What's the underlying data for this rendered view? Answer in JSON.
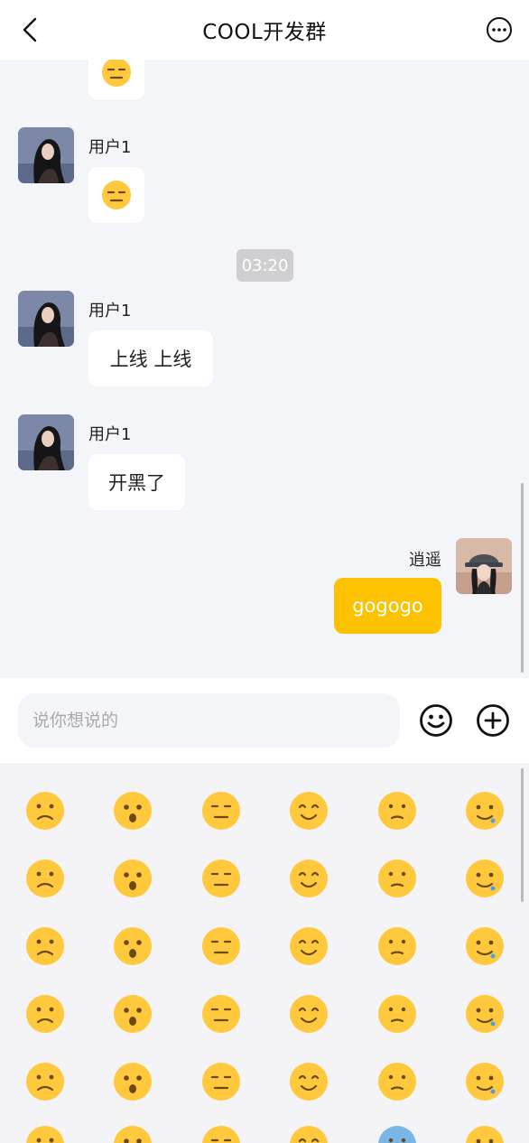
{
  "header": {
    "title": "COOL开发群"
  },
  "chat": {
    "messages": [
      {
        "name": "用户1",
        "type": "emoji",
        "content": "😑"
      },
      {
        "name": "用户1",
        "type": "emoji",
        "content": "😑"
      },
      {
        "name": "用户1",
        "type": "text",
        "content": "上线 上线"
      },
      {
        "name": "用户1",
        "type": "text",
        "content": "开黑了"
      },
      {
        "name": "逍遥",
        "type": "text",
        "content": "gogogo"
      }
    ],
    "time_divider": "03:20"
  },
  "input": {
    "placeholder": "说你想说的"
  },
  "colors": {
    "accent": "#fcc200",
    "background": "#f4f5f9",
    "emoji_face": "#ffc83d"
  },
  "emoji_panel": {
    "emojis": [
      "😠",
      "😧",
      "😲",
      "😖",
      "😕",
      "😢",
      "😥",
      "😞",
      "😵",
      "🤤",
      "😑",
      "😋",
      "😱",
      "😘",
      "😓",
      "🤠",
      "🤫",
      "🤕",
      "😤",
      "😷",
      "🧐",
      "🤨",
      "😰",
      "🤮",
      "😮",
      "🥳",
      "🥺",
      "🙄",
      "😝",
      "😜",
      "😐",
      "😐",
      "😐",
      "😐",
      "😰",
      "😐"
    ]
  }
}
